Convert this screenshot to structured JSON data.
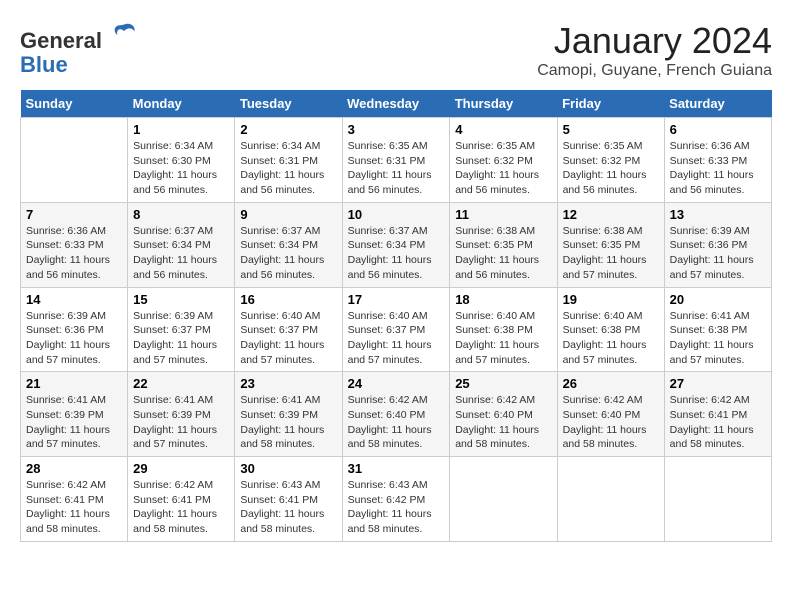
{
  "header": {
    "logo_line1": "General",
    "logo_line2": "Blue",
    "month": "January 2024",
    "location": "Camopi, Guyane, French Guiana"
  },
  "days_of_week": [
    "Sunday",
    "Monday",
    "Tuesday",
    "Wednesday",
    "Thursday",
    "Friday",
    "Saturday"
  ],
  "weeks": [
    [
      {
        "day": "",
        "content": ""
      },
      {
        "day": "1",
        "sunrise": "6:34 AM",
        "sunset": "6:30 PM",
        "daylight": "11 hours and 56 minutes."
      },
      {
        "day": "2",
        "sunrise": "6:34 AM",
        "sunset": "6:31 PM",
        "daylight": "11 hours and 56 minutes."
      },
      {
        "day": "3",
        "sunrise": "6:35 AM",
        "sunset": "6:31 PM",
        "daylight": "11 hours and 56 minutes."
      },
      {
        "day": "4",
        "sunrise": "6:35 AM",
        "sunset": "6:32 PM",
        "daylight": "11 hours and 56 minutes."
      },
      {
        "day": "5",
        "sunrise": "6:35 AM",
        "sunset": "6:32 PM",
        "daylight": "11 hours and 56 minutes."
      },
      {
        "day": "6",
        "sunrise": "6:36 AM",
        "sunset": "6:33 PM",
        "daylight": "11 hours and 56 minutes."
      }
    ],
    [
      {
        "day": "7",
        "sunrise": "6:36 AM",
        "sunset": "6:33 PM",
        "daylight": "11 hours and 56 minutes."
      },
      {
        "day": "8",
        "sunrise": "6:37 AM",
        "sunset": "6:34 PM",
        "daylight": "11 hours and 56 minutes."
      },
      {
        "day": "9",
        "sunrise": "6:37 AM",
        "sunset": "6:34 PM",
        "daylight": "11 hours and 56 minutes."
      },
      {
        "day": "10",
        "sunrise": "6:37 AM",
        "sunset": "6:34 PM",
        "daylight": "11 hours and 56 minutes."
      },
      {
        "day": "11",
        "sunrise": "6:38 AM",
        "sunset": "6:35 PM",
        "daylight": "11 hours and 56 minutes."
      },
      {
        "day": "12",
        "sunrise": "6:38 AM",
        "sunset": "6:35 PM",
        "daylight": "11 hours and 57 minutes."
      },
      {
        "day": "13",
        "sunrise": "6:39 AM",
        "sunset": "6:36 PM",
        "daylight": "11 hours and 57 minutes."
      }
    ],
    [
      {
        "day": "14",
        "sunrise": "6:39 AM",
        "sunset": "6:36 PM",
        "daylight": "11 hours and 57 minutes."
      },
      {
        "day": "15",
        "sunrise": "6:39 AM",
        "sunset": "6:37 PM",
        "daylight": "11 hours and 57 minutes."
      },
      {
        "day": "16",
        "sunrise": "6:40 AM",
        "sunset": "6:37 PM",
        "daylight": "11 hours and 57 minutes."
      },
      {
        "day": "17",
        "sunrise": "6:40 AM",
        "sunset": "6:37 PM",
        "daylight": "11 hours and 57 minutes."
      },
      {
        "day": "18",
        "sunrise": "6:40 AM",
        "sunset": "6:38 PM",
        "daylight": "11 hours and 57 minutes."
      },
      {
        "day": "19",
        "sunrise": "6:40 AM",
        "sunset": "6:38 PM",
        "daylight": "11 hours and 57 minutes."
      },
      {
        "day": "20",
        "sunrise": "6:41 AM",
        "sunset": "6:38 PM",
        "daylight": "11 hours and 57 minutes."
      }
    ],
    [
      {
        "day": "21",
        "sunrise": "6:41 AM",
        "sunset": "6:39 PM",
        "daylight": "11 hours and 57 minutes."
      },
      {
        "day": "22",
        "sunrise": "6:41 AM",
        "sunset": "6:39 PM",
        "daylight": "11 hours and 57 minutes."
      },
      {
        "day": "23",
        "sunrise": "6:41 AM",
        "sunset": "6:39 PM",
        "daylight": "11 hours and 58 minutes."
      },
      {
        "day": "24",
        "sunrise": "6:42 AM",
        "sunset": "6:40 PM",
        "daylight": "11 hours and 58 minutes."
      },
      {
        "day": "25",
        "sunrise": "6:42 AM",
        "sunset": "6:40 PM",
        "daylight": "11 hours and 58 minutes."
      },
      {
        "day": "26",
        "sunrise": "6:42 AM",
        "sunset": "6:40 PM",
        "daylight": "11 hours and 58 minutes."
      },
      {
        "day": "27",
        "sunrise": "6:42 AM",
        "sunset": "6:41 PM",
        "daylight": "11 hours and 58 minutes."
      }
    ],
    [
      {
        "day": "28",
        "sunrise": "6:42 AM",
        "sunset": "6:41 PM",
        "daylight": "11 hours and 58 minutes."
      },
      {
        "day": "29",
        "sunrise": "6:42 AM",
        "sunset": "6:41 PM",
        "daylight": "11 hours and 58 minutes."
      },
      {
        "day": "30",
        "sunrise": "6:43 AM",
        "sunset": "6:41 PM",
        "daylight": "11 hours and 58 minutes."
      },
      {
        "day": "31",
        "sunrise": "6:43 AM",
        "sunset": "6:42 PM",
        "daylight": "11 hours and 58 minutes."
      },
      {
        "day": "",
        "content": ""
      },
      {
        "day": "",
        "content": ""
      },
      {
        "day": "",
        "content": ""
      }
    ]
  ]
}
